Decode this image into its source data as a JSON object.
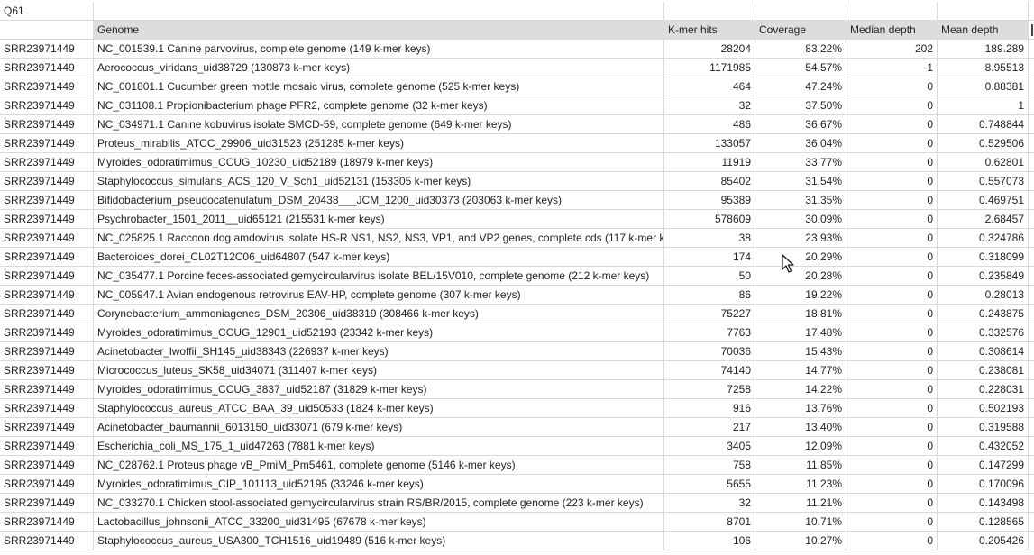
{
  "top_cell": "Q61",
  "headers": [
    "",
    "Genome",
    "K-mer hits",
    "Coverage",
    "Median depth",
    "Mean depth"
  ],
  "rows": [
    [
      "SRR23971449",
      "NC_001539.1 Canine parvovirus, complete genome (149 k-mer keys)",
      "28204",
      "83.22%",
      "202",
      "189.289"
    ],
    [
      "SRR23971449",
      "Aerococcus_viridans_uid38729 (130873 k-mer keys)",
      "1171985",
      "54.57%",
      "1",
      "8.95513"
    ],
    [
      "SRR23971449",
      "NC_001801.1 Cucumber green mottle mosaic virus, complete genome (525 k-mer keys)",
      "464",
      "47.24%",
      "0",
      "0.88381"
    ],
    [
      "SRR23971449",
      "NC_031108.1 Propionibacterium phage PFR2, complete genome (32 k-mer keys)",
      "32",
      "37.50%",
      "0",
      "1"
    ],
    [
      "SRR23971449",
      "NC_034971.1 Canine kobuvirus isolate SMCD-59, complete genome (649 k-mer keys)",
      "486",
      "36.67%",
      "0",
      "0.748844"
    ],
    [
      "SRR23971449",
      "Proteus_mirabilis_ATCC_29906_uid31523 (251285 k-mer keys)",
      "133057",
      "36.04%",
      "0",
      "0.529506"
    ],
    [
      "SRR23971449",
      "Myroides_odoratimimus_CCUG_10230_uid52189 (18979 k-mer keys)",
      "11919",
      "33.77%",
      "0",
      "0.62801"
    ],
    [
      "SRR23971449",
      "Staphylococcus_simulans_ACS_120_V_Sch1_uid52131 (153305 k-mer keys)",
      "85402",
      "31.54%",
      "0",
      "0.557073"
    ],
    [
      "SRR23971449",
      "Bifidobacterium_pseudocatenulatum_DSM_20438___JCM_1200_uid30373 (203063 k-mer keys)",
      "95389",
      "31.35%",
      "0",
      "0.469751"
    ],
    [
      "SRR23971449",
      "Psychrobacter_1501_2011__uid65121 (215531 k-mer keys)",
      "578609",
      "30.09%",
      "0",
      "2.68457"
    ],
    [
      "SRR23971449",
      "NC_025825.1 Raccoon dog amdovirus isolate HS-R NS1, NS2, NS3, VP1, and VP2 genes, complete cds (117 k-mer k",
      "38",
      "23.93%",
      "0",
      "0.324786"
    ],
    [
      "SRR23971449",
      "Bacteroides_dorei_CL02T12C06_uid64807 (547 k-mer keys)",
      "174",
      "20.29%",
      "0",
      "0.318099"
    ],
    [
      "SRR23971449",
      "NC_035477.1 Porcine feces-associated gemycircularvirus isolate BEL/15V010, complete genome (212 k-mer keys)",
      "50",
      "20.28%",
      "0",
      "0.235849"
    ],
    [
      "SRR23971449",
      "NC_005947.1 Avian endogenous retrovirus EAV-HP, complete genome (307 k-mer keys)",
      "86",
      "19.22%",
      "0",
      "0.28013"
    ],
    [
      "SRR23971449",
      "Corynebacterium_ammoniagenes_DSM_20306_uid38319 (308466 k-mer keys)",
      "75227",
      "18.81%",
      "0",
      "0.243875"
    ],
    [
      "SRR23971449",
      "Myroides_odoratimimus_CCUG_12901_uid52193 (23342 k-mer keys)",
      "7763",
      "17.48%",
      "0",
      "0.332576"
    ],
    [
      "SRR23971449",
      "Acinetobacter_lwoffii_SH145_uid38343 (226937 k-mer keys)",
      "70036",
      "15.43%",
      "0",
      "0.308614"
    ],
    [
      "SRR23971449",
      "Micrococcus_luteus_SK58_uid34071 (311407 k-mer keys)",
      "74140",
      "14.77%",
      "0",
      "0.238081"
    ],
    [
      "SRR23971449",
      "Myroides_odoratimimus_CCUG_3837_uid52187 (31829 k-mer keys)",
      "7258",
      "14.22%",
      "0",
      "0.228031"
    ],
    [
      "SRR23971449",
      "Staphylococcus_aureus_ATCC_BAA_39_uid50533 (1824 k-mer keys)",
      "916",
      "13.76%",
      "0",
      "0.502193"
    ],
    [
      "SRR23971449",
      "Acinetobacter_baumannii_6013150_uid33071 (679 k-mer keys)",
      "217",
      "13.40%",
      "0",
      "0.319588"
    ],
    [
      "SRR23971449",
      "Escherichia_coli_MS_175_1_uid47263 (7881 k-mer keys)",
      "3405",
      "12.09%",
      "0",
      "0.432052"
    ],
    [
      "SRR23971449",
      "NC_028762.1 Proteus phage vB_PmiM_Pm5461, complete genome (5146 k-mer keys)",
      "758",
      "11.85%",
      "0",
      "0.147299"
    ],
    [
      "SRR23971449",
      "Myroides_odoratimimus_CIP_101113_uid52195 (33246 k-mer keys)",
      "5655",
      "11.23%",
      "0",
      "0.170096"
    ],
    [
      "SRR23971449",
      "NC_033270.1 Chicken stool-associated gemycircularvirus strain RS/BR/2015, complete genome (223 k-mer keys)",
      "32",
      "11.21%",
      "0",
      "0.143498"
    ],
    [
      "SRR23971449",
      "Lactobacillus_johnsonii_ATCC_33200_uid31495 (67678 k-mer keys)",
      "8701",
      "10.71%",
      "0",
      "0.128565"
    ],
    [
      "SRR23971449",
      "Staphylococcus_aureus_USA300_TCH1516_uid19489 (516 k-mer keys)",
      "106",
      "10.27%",
      "0",
      "0.205426"
    ]
  ]
}
